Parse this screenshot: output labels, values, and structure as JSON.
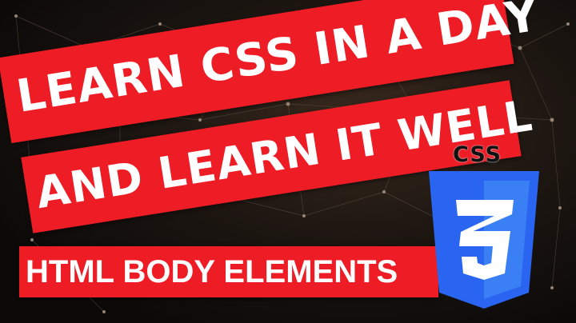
{
  "thumbnail": {
    "headline_line1": "LEARN CSS IN A DAY",
    "headline_line2": "AND LEARN IT WELL",
    "subtitle": "HTML BODY ELEMENTS",
    "logo_text": "CSS"
  },
  "colors": {
    "banner_red": "#ee1c25",
    "banner_text": "#ffffff",
    "shield_blue": "#2965f1",
    "shield_light_blue": "#3b7ff5",
    "background": "#0f0c0a"
  },
  "icons": {
    "logo": "css3-shield-icon"
  }
}
